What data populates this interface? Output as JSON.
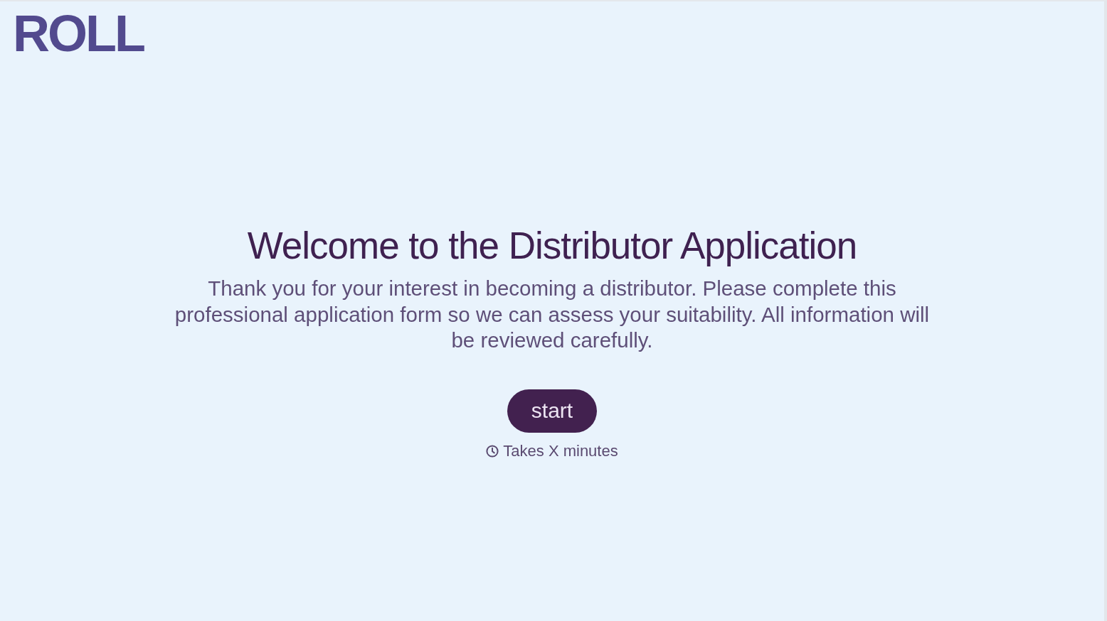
{
  "header": {
    "logo": "ROLL"
  },
  "welcome": {
    "title": "Welcome to the Distributor Application",
    "description": "Thank you for your interest in becoming a distributor. Please complete this professional application form so we can assess your suitability. All information will be reviewed carefully.",
    "start_button": "start",
    "duration": "Takes X minutes"
  }
}
